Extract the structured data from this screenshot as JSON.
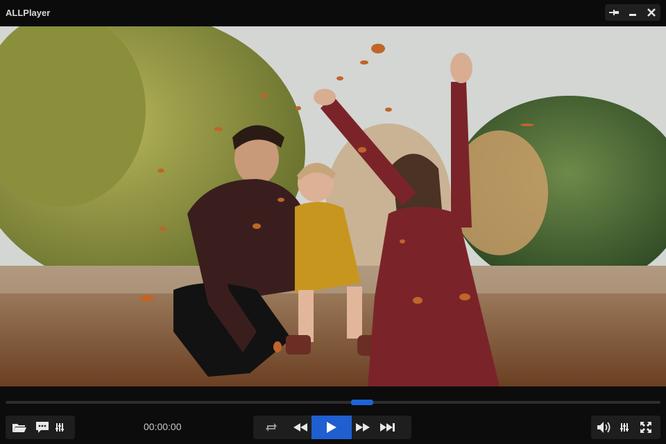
{
  "app": {
    "title": "ALLPlayer"
  },
  "window_controls": {
    "pin_icon": "pin-icon",
    "minimize_icon": "minimize-icon",
    "close_icon": "close-icon"
  },
  "video": {
    "description_icon": "video-frame"
  },
  "playback": {
    "current_time": "00:00:00",
    "progress": 0.545
  },
  "controls": {
    "left": [
      "open-folder-icon",
      "subtitles-icon",
      "equalizer-icon"
    ],
    "center": [
      "repeat-icon",
      "rewind-icon",
      "play-icon",
      "fast-forward-icon",
      "skip-next-icon"
    ],
    "right": [
      "volume-icon",
      "audio-settings-icon",
      "fullscreen-icon"
    ]
  },
  "colors": {
    "accent": "#1f5fd0",
    "bar_bg": "#0c0c0c",
    "group_bg": "#1e1e1e"
  }
}
